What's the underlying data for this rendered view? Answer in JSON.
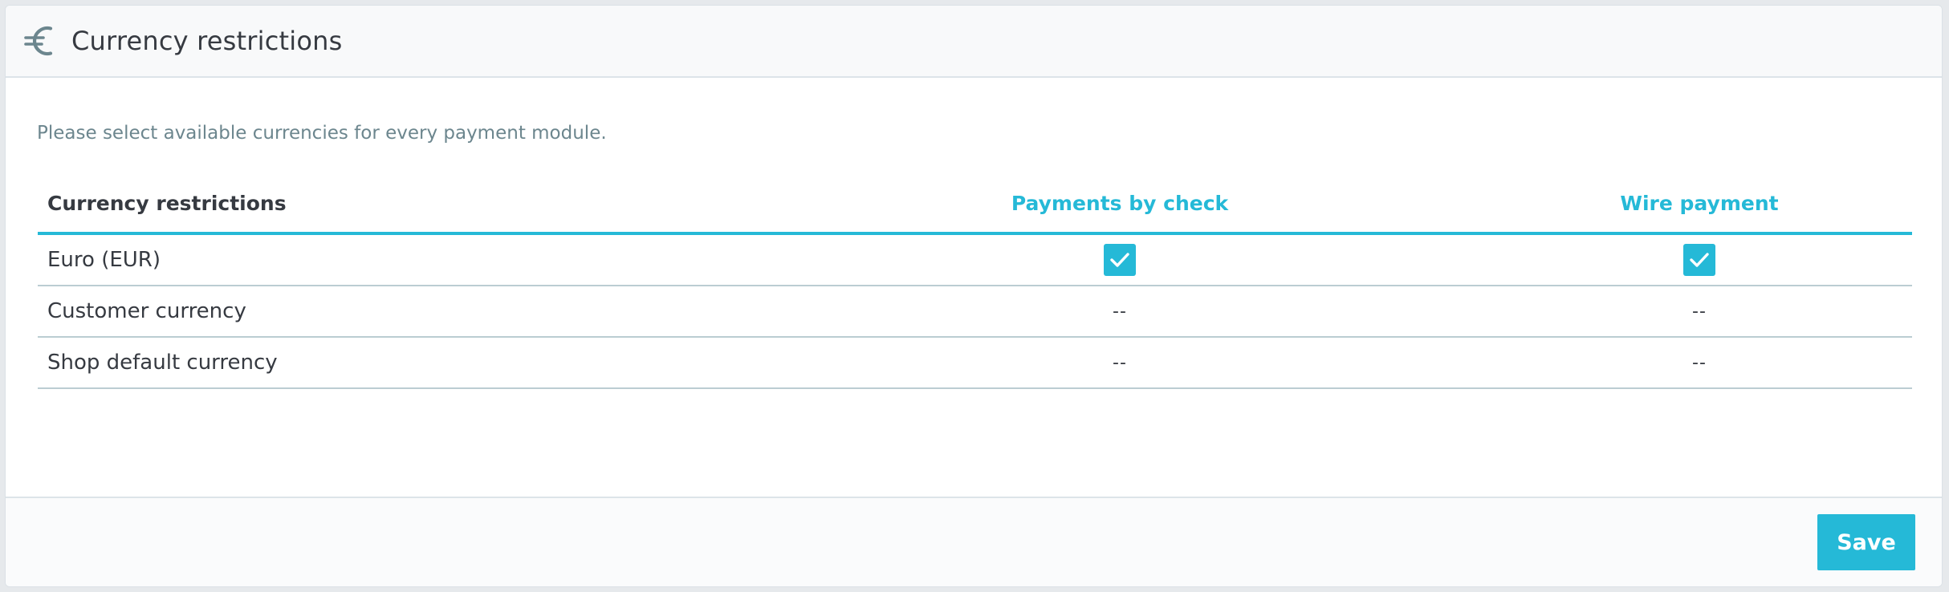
{
  "panel": {
    "title": "Currency restrictions",
    "icon": "euro-icon"
  },
  "body": {
    "help_text": "Please select available currencies for every payment module."
  },
  "table": {
    "headers": {
      "name": "Currency restrictions",
      "modules": [
        "Payments by check",
        "Wire payment"
      ]
    },
    "rows": [
      {
        "label": "Euro (EUR)",
        "cells": [
          {
            "type": "checkbox",
            "checked": true
          },
          {
            "type": "checkbox",
            "checked": true
          }
        ]
      },
      {
        "label": "Customer currency",
        "cells": [
          {
            "type": "text",
            "value": "--"
          },
          {
            "type": "text",
            "value": "--"
          }
        ]
      },
      {
        "label": "Shop default currency",
        "cells": [
          {
            "type": "text",
            "value": "--"
          },
          {
            "type": "text",
            "value": "--"
          }
        ]
      }
    ]
  },
  "footer": {
    "save_label": "Save"
  },
  "colors": {
    "accent": "#25b9d7",
    "text": "#363a41",
    "muted": "#6c868e"
  }
}
